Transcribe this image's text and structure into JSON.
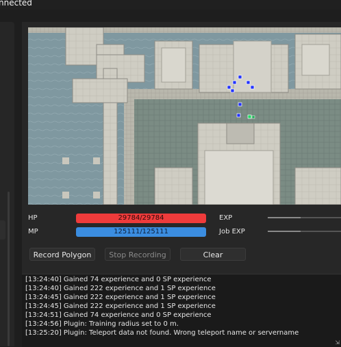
{
  "window": {
    "title": "nnected"
  },
  "stats": {
    "hp_label": "HP",
    "hp_value": "29784/29784",
    "mp_label": "MP",
    "mp_value": "125111/125111",
    "exp_label": "EXP",
    "job_exp_label": "Job EXP",
    "exp_progress": 0.45,
    "job_exp_progress": 0.45
  },
  "buttons": {
    "record_polygon": "Record Polygon",
    "stop_recording": "Stop Recording",
    "clear": "Clear"
  },
  "log": {
    "lines": [
      "[13:24:40] Gained 74 experience and 0 SP experience",
      "[13:24:40] Gained 222 experience and 1 SP experience",
      "[13:24:45] Gained 222 experience and 1 SP experience",
      "[13:24:45] Gained 222 experience and 1 SP experience",
      "[13:24:51] Gained 74 experience and 0 SP experience",
      "[13:24:56] Plugin: Training radius set to 0 m.",
      "[13:25:20] Plugin: Teleport data not found. Wrong teleport name or servername"
    ]
  },
  "colors": {
    "hp_bar": "#ef3b3b",
    "mp_bar": "#3b8de0",
    "marker_blue": "#2233ff",
    "marker_player": "#22dd66"
  }
}
